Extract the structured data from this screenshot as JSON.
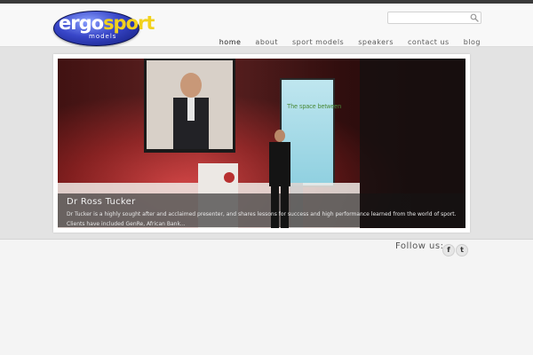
{
  "brand": {
    "logo_word_1": "ergo",
    "logo_word_2": "sport",
    "logo_sub": "models",
    "colors": {
      "logo_blue": "#3846c8",
      "logo_yellow": "#f2d21c"
    }
  },
  "search": {
    "value": "",
    "placeholder": "",
    "icon": "search-icon"
  },
  "nav": {
    "items": [
      {
        "label": "home",
        "active": true
      },
      {
        "label": "about"
      },
      {
        "label": "sport models"
      },
      {
        "label": "speakers"
      },
      {
        "label": "contact us"
      },
      {
        "label": "blog"
      }
    ]
  },
  "slider": {
    "caption_title": "Dr Ross Tucker",
    "caption_text": "Dr Tucker is a highly sought after and acclaimed presenter, and shares lessons for success and high performance learned from the world of sport. Clients have included GenRe, African Bank...",
    "slide_screen_text": "The space between"
  },
  "social": {
    "label": "Follow us:",
    "facebook_glyph": "f",
    "twitter_glyph": "t",
    "icons": [
      "facebook-icon",
      "twitter-icon"
    ]
  }
}
